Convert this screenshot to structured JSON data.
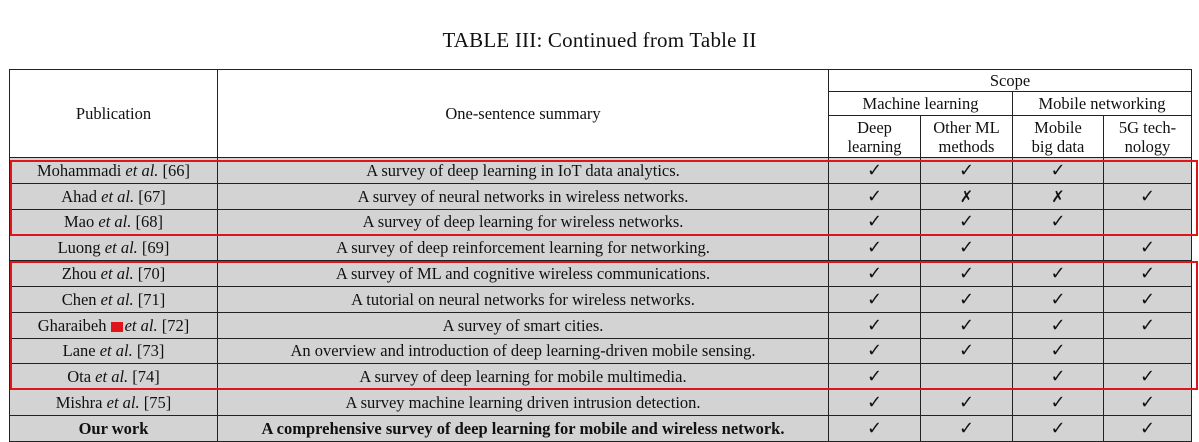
{
  "caption": "TABLE III: Continued from Table II",
  "header": {
    "publication": "Publication",
    "summary": "One-sentence summary",
    "scope": "Scope",
    "group_ml": "Machine learning",
    "group_mn": "Mobile networking",
    "col_deep": [
      "Deep",
      "learning"
    ],
    "col_other": [
      "Other ML",
      "methods"
    ],
    "col_bigdata": [
      "Mobile",
      "big data"
    ],
    "col_5g": [
      "5G tech-",
      "nology"
    ]
  },
  "symbols": {
    "check": "✓",
    "cross": "✗"
  },
  "colors": {
    "row_background": "#d3d3d3",
    "highlight": "#e0151b"
  },
  "rows": [
    {
      "pub_pre": "Mohammadi ",
      "etal": "et al.",
      "pub_post": " [66]",
      "summary": "A survey of deep learning in IoT data analytics.",
      "marks": [
        "check",
        "check",
        "check",
        ""
      ]
    },
    {
      "pub_pre": "Ahad ",
      "etal": "et al.",
      "pub_post": " [67]",
      "summary": "A survey of neural networks in wireless networks.",
      "marks": [
        "check",
        "cross",
        "cross",
        "check"
      ]
    },
    {
      "pub_pre": "Mao ",
      "etal": "et al.",
      "pub_post": " [68]",
      "summary": "A survey of deep learning for wireless networks.",
      "marks": [
        "check",
        "check",
        "check",
        ""
      ]
    },
    {
      "pub_pre": "Luong ",
      "etal": "et al.",
      "pub_post": " [69]",
      "summary": "A survey of deep reinforcement learning for networking.",
      "marks": [
        "check",
        "check",
        "",
        "check"
      ]
    },
    {
      "pub_pre": "Zhou ",
      "etal": "et al.",
      "pub_post": " [70]",
      "summary": "A survey of ML and cognitive wireless communications.",
      "marks": [
        "check",
        "check",
        "check",
        "check"
      ]
    },
    {
      "pub_pre": "Chen ",
      "etal": "et al.",
      "pub_post": " [71]",
      "summary": "A tutorial on neural networks for wireless networks.",
      "marks": [
        "check",
        "check",
        "check",
        "check"
      ]
    },
    {
      "pub_pre": "Gharaibeh ",
      "etal": "et al.",
      "pub_post": " [72]",
      "summary": "A survey of smart cities.",
      "marks": [
        "check",
        "check",
        "check",
        "check"
      ],
      "annotated": true
    },
    {
      "pub_pre": "Lane ",
      "etal": "et al.",
      "pub_post": " [73]",
      "summary": "An overview and introduction of deep learning-driven mobile sensing.",
      "marks": [
        "check",
        "check",
        "check",
        ""
      ]
    },
    {
      "pub_pre": "Ota ",
      "etal": "et al.",
      "pub_post": " [74]",
      "summary": "A survey of deep learning for mobile multimedia.",
      "marks": [
        "check",
        "",
        "check",
        "check"
      ]
    },
    {
      "pub_pre": "Mishra ",
      "etal": "et al.",
      "pub_post": " [75]",
      "summary": "A survey machine learning driven intrusion detection.",
      "marks": [
        "check",
        "check",
        "check",
        "check"
      ]
    },
    {
      "pub_pre": "Our work",
      "etal": "",
      "pub_post": "",
      "summary": "A comprehensive survey of deep learning for mobile and wireless network.",
      "marks": [
        "check",
        "check",
        "check",
        "check"
      ],
      "bold": true
    }
  ]
}
